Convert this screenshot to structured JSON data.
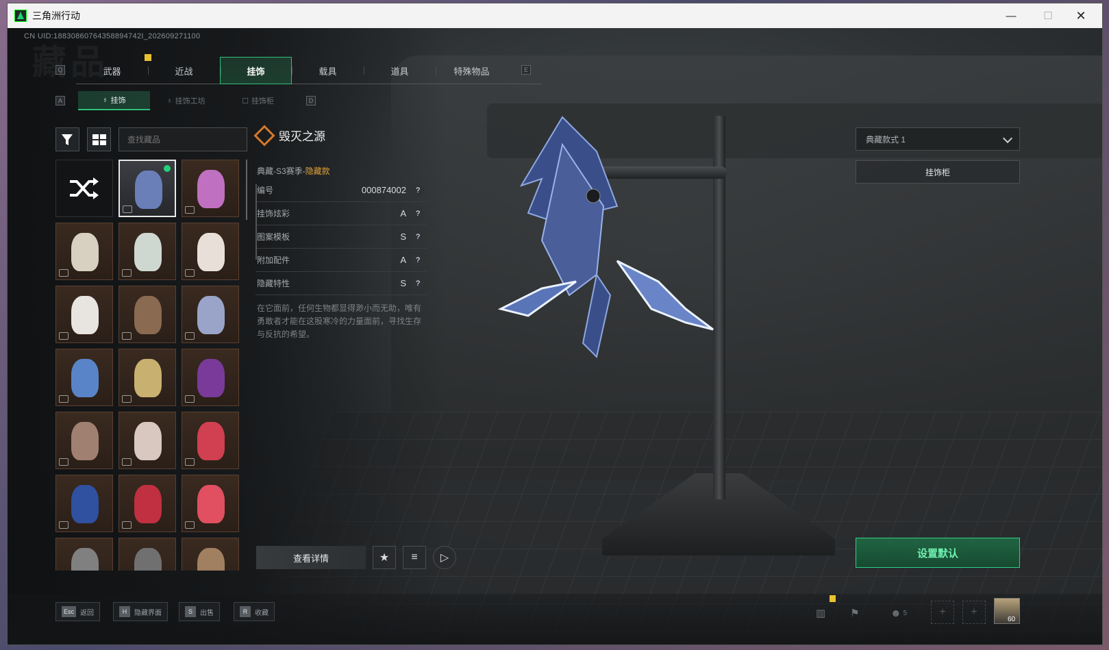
{
  "window": {
    "title": "三角洲行动",
    "min": "—",
    "max": "☐",
    "close": "✕"
  },
  "uid": "CN UID:18830860764358894742I_202609271100",
  "bg_title": "藏品",
  "main_tabs": {
    "key_left": "Q",
    "key_right": "E",
    "items": [
      {
        "label": "武器"
      },
      {
        "label": "近战"
      },
      {
        "label": "挂饰"
      },
      {
        "label": "载具"
      },
      {
        "label": "道具"
      },
      {
        "label": "特殊物品"
      }
    ]
  },
  "sub_tabs": {
    "key_left": "A",
    "key_right": "D",
    "items": [
      {
        "label": "挂饰"
      },
      {
        "label": "挂饰工坊"
      },
      {
        "label": "挂饰柜"
      }
    ]
  },
  "search": {
    "placeholder": "查找藏品"
  },
  "grid": {
    "shuffle_icon": "shuffle-icon",
    "items": [
      {
        "color": "#6a7fb8"
      },
      {
        "color": "#c070c0"
      },
      {
        "color": "#d8d0c0"
      },
      {
        "color": "#cfd8d0"
      },
      {
        "color": "#e8e0d8"
      },
      {
        "color": "#e8e4e0"
      },
      {
        "color": "#8a6a50"
      },
      {
        "color": "#9aa4c8"
      },
      {
        "color": "#5a84c8"
      },
      {
        "color": "#c8b070"
      },
      {
        "color": "#7a3a9a"
      },
      {
        "color": "#a08070"
      },
      {
        "color": "#d8c8c0"
      },
      {
        "color": "#d04050"
      },
      {
        "color": "#3050a0"
      },
      {
        "color": "#c03040"
      },
      {
        "color": "#e05060"
      },
      {
        "color": "#808080"
      },
      {
        "color": "#707070"
      },
      {
        "color": "#a08060"
      }
    ]
  },
  "detail": {
    "name": "毁灭之源",
    "meta_prefix": "典藏-S3赛季-",
    "meta_highlight": "隐藏款",
    "attrs": [
      {
        "label": "编号",
        "value": "000874002"
      },
      {
        "label": "挂饰炫彩",
        "value": "A"
      },
      {
        "label": "图案模板",
        "value": "S"
      },
      {
        "label": "附加配件",
        "value": "A"
      },
      {
        "label": "隐藏特性",
        "value": "S"
      }
    ],
    "question": "?",
    "description": "在它面前，任何生物都显得渺小而无助，唯有勇敢者才能在这股寒冷的力量面前，寻找生存与反抗的希望。"
  },
  "actions": {
    "view_detail": "查看详情",
    "star": "★",
    "filter_list": "≡",
    "play": "▷"
  },
  "right_panel": {
    "style_select": "典藏款式 1",
    "cabinet": "挂饰柜",
    "set_default": "设置默认"
  },
  "bottom": {
    "hints": [
      {
        "key": "Esc",
        "label": "返回"
      },
      {
        "key": "H",
        "label": "隐藏界面"
      },
      {
        "key": "S",
        "label": "出售"
      },
      {
        "key": "R",
        "label": "收藏"
      }
    ],
    "friends_count": "5",
    "plus": "+",
    "avatar_level": "60"
  },
  "colors": {
    "accent": "#2fbf7a",
    "highlight": "#e0a13a",
    "warning": "#e8c230"
  }
}
